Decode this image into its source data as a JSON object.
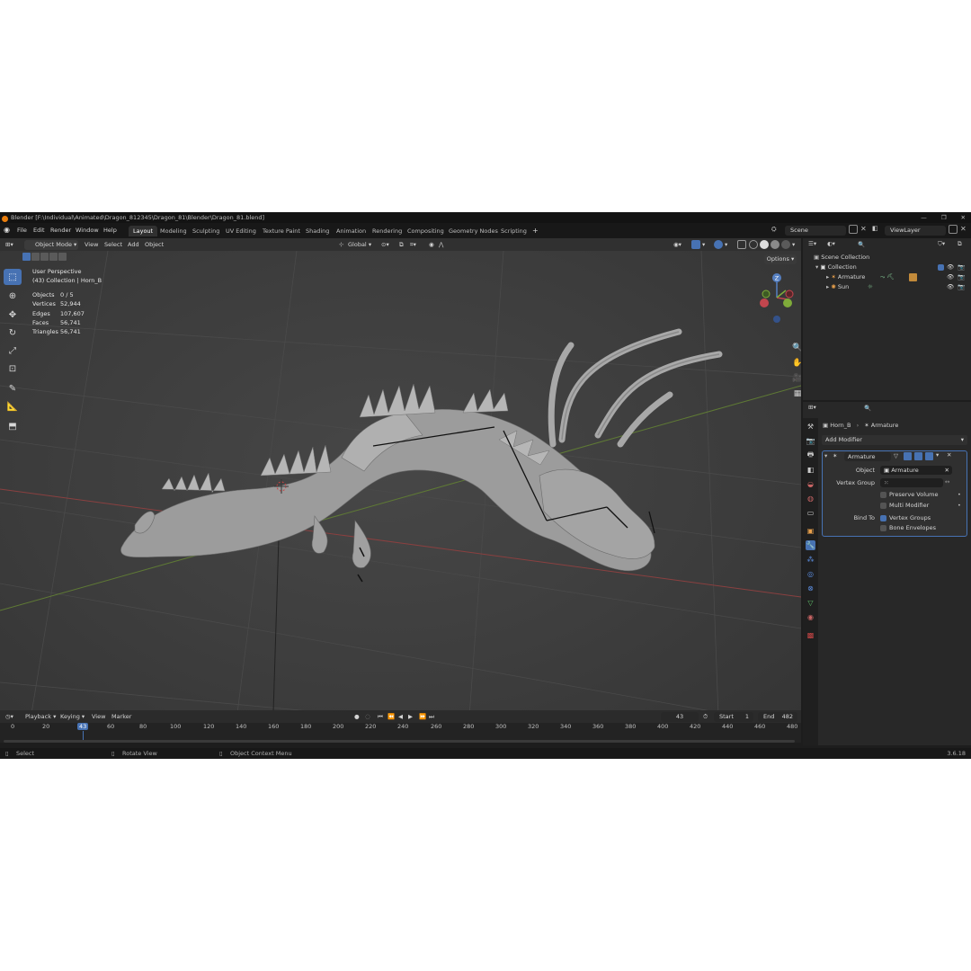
{
  "window": {
    "title": "Blender [F:\\Individual\\Animated\\Dragon_812345\\Dragon_81\\Blender\\Dragon_81.blend]",
    "controls": [
      "—",
      "❐",
      "✕"
    ]
  },
  "menu": [
    "File",
    "Edit",
    "Render",
    "Window",
    "Help"
  ],
  "workspaces": [
    "Layout",
    "Modeling",
    "Sculpting",
    "UV Editing",
    "Texture Paint",
    "Shading",
    "Animation",
    "Rendering",
    "Compositing",
    "Geometry Nodes",
    "Scripting"
  ],
  "active_workspace": "Layout",
  "add_workspace": "+",
  "scene": "Scene",
  "view_layer": "ViewLayer",
  "viewport_header": {
    "mode": "Object Mode",
    "menus": [
      "View",
      "Select",
      "Add",
      "Object"
    ],
    "orientation": "Global"
  },
  "viewport": {
    "perspective": "User Perspective",
    "collection": "(43) Collection | Horn_B",
    "options": "Options",
    "stats": [
      {
        "label": "Objects",
        "value": "0 / 5"
      },
      {
        "label": "Vertices",
        "value": "52,944"
      },
      {
        "label": "Edges",
        "value": "107,607"
      },
      {
        "label": "Faces",
        "value": "56,741"
      },
      {
        "label": "Triangles",
        "value": "56,741"
      }
    ],
    "gizmo": {
      "x": "X",
      "y": "Y",
      "z": "Z"
    }
  },
  "outliner": {
    "scene_collection": "Scene Collection",
    "collection": "Collection",
    "items": [
      "Armature",
      "Sun"
    ]
  },
  "properties": {
    "breadcrumb_object": "Horn_B",
    "breadcrumb_modifier": "Armature",
    "add_modifier": "Add Modifier",
    "modifier_name": "Armature",
    "object_label": "Object",
    "object_value": "Armature",
    "vertex_group_label": "Vertex Group",
    "vertex_group_value": "",
    "preserve_volume": "Preserve Volume",
    "multi_modifier": "Multi Modifier",
    "bind_to_label": "Bind To",
    "vertex_groups": "Vertex Groups",
    "bone_envelopes": "Bone Envelopes"
  },
  "timeline": {
    "menus": [
      "Playback",
      "Keying",
      "View",
      "Marker"
    ],
    "current_frame": "43",
    "start_label": "Start",
    "start": "1",
    "end_label": "End",
    "end": "482",
    "ticks": [
      "0",
      "20",
      "43",
      "60",
      "80",
      "100",
      "120",
      "140",
      "160",
      "180",
      "200",
      "220",
      "240",
      "260",
      "280",
      "300",
      "320",
      "340",
      "360",
      "380",
      "400",
      "420",
      "440",
      "460",
      "480"
    ]
  },
  "statusbar": {
    "select": "Select",
    "rotate": "Rotate View",
    "context": "Object Context Menu",
    "version": "3.6.18"
  }
}
